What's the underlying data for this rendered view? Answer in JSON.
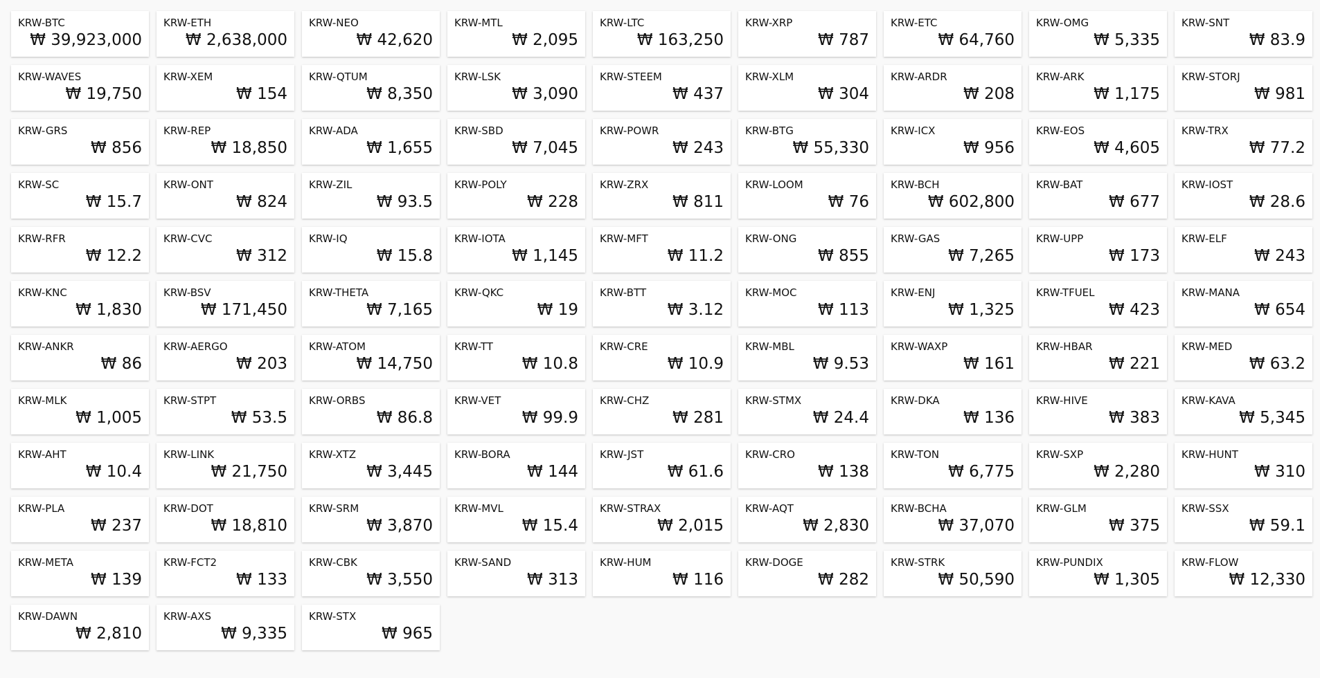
{
  "currency_symbol": "₩",
  "tickers": [
    {
      "market": "KRW-BTC",
      "price": "39,923,000"
    },
    {
      "market": "KRW-ETH",
      "price": "2,638,000"
    },
    {
      "market": "KRW-NEO",
      "price": "42,620"
    },
    {
      "market": "KRW-MTL",
      "price": "2,095"
    },
    {
      "market": "KRW-LTC",
      "price": "163,250"
    },
    {
      "market": "KRW-XRP",
      "price": "787"
    },
    {
      "market": "KRW-ETC",
      "price": "64,760"
    },
    {
      "market": "KRW-OMG",
      "price": "5,335"
    },
    {
      "market": "KRW-SNT",
      "price": "83.9"
    },
    {
      "market": "KRW-WAVES",
      "price": "19,750"
    },
    {
      "market": "KRW-XEM",
      "price": "154"
    },
    {
      "market": "KRW-QTUM",
      "price": "8,350"
    },
    {
      "market": "KRW-LSK",
      "price": "3,090"
    },
    {
      "market": "KRW-STEEM",
      "price": "437"
    },
    {
      "market": "KRW-XLM",
      "price": "304"
    },
    {
      "market": "KRW-ARDR",
      "price": "208"
    },
    {
      "market": "KRW-ARK",
      "price": "1,175"
    },
    {
      "market": "KRW-STORJ",
      "price": "981"
    },
    {
      "market": "KRW-GRS",
      "price": "856"
    },
    {
      "market": "KRW-REP",
      "price": "18,850"
    },
    {
      "market": "KRW-ADA",
      "price": "1,655"
    },
    {
      "market": "KRW-SBD",
      "price": "7,045"
    },
    {
      "market": "KRW-POWR",
      "price": "243"
    },
    {
      "market": "KRW-BTG",
      "price": "55,330"
    },
    {
      "market": "KRW-ICX",
      "price": "956"
    },
    {
      "market": "KRW-EOS",
      "price": "4,605"
    },
    {
      "market": "KRW-TRX",
      "price": "77.2"
    },
    {
      "market": "KRW-SC",
      "price": "15.7"
    },
    {
      "market": "KRW-ONT",
      "price": "824"
    },
    {
      "market": "KRW-ZIL",
      "price": "93.5"
    },
    {
      "market": "KRW-POLY",
      "price": "228"
    },
    {
      "market": "KRW-ZRX",
      "price": "811"
    },
    {
      "market": "KRW-LOOM",
      "price": "76"
    },
    {
      "market": "KRW-BCH",
      "price": "602,800"
    },
    {
      "market": "KRW-BAT",
      "price": "677"
    },
    {
      "market": "KRW-IOST",
      "price": "28.6"
    },
    {
      "market": "KRW-RFR",
      "price": "12.2"
    },
    {
      "market": "KRW-CVC",
      "price": "312"
    },
    {
      "market": "KRW-IQ",
      "price": "15.8"
    },
    {
      "market": "KRW-IOTA",
      "price": "1,145"
    },
    {
      "market": "KRW-MFT",
      "price": "11.2"
    },
    {
      "market": "KRW-ONG",
      "price": "855"
    },
    {
      "market": "KRW-GAS",
      "price": "7,265"
    },
    {
      "market": "KRW-UPP",
      "price": "173"
    },
    {
      "market": "KRW-ELF",
      "price": "243"
    },
    {
      "market": "KRW-KNC",
      "price": "1,830"
    },
    {
      "market": "KRW-BSV",
      "price": "171,450"
    },
    {
      "market": "KRW-THETA",
      "price": "7,165"
    },
    {
      "market": "KRW-QKC",
      "price": "19"
    },
    {
      "market": "KRW-BTT",
      "price": "3.12"
    },
    {
      "market": "KRW-MOC",
      "price": "113"
    },
    {
      "market": "KRW-ENJ",
      "price": "1,325"
    },
    {
      "market": "KRW-TFUEL",
      "price": "423"
    },
    {
      "market": "KRW-MANA",
      "price": "654"
    },
    {
      "market": "KRW-ANKR",
      "price": "86"
    },
    {
      "market": "KRW-AERGO",
      "price": "203"
    },
    {
      "market": "KRW-ATOM",
      "price": "14,750"
    },
    {
      "market": "KRW-TT",
      "price": "10.8"
    },
    {
      "market": "KRW-CRE",
      "price": "10.9"
    },
    {
      "market": "KRW-MBL",
      "price": "9.53"
    },
    {
      "market": "KRW-WAXP",
      "price": "161"
    },
    {
      "market": "KRW-HBAR",
      "price": "221"
    },
    {
      "market": "KRW-MED",
      "price": "63.2"
    },
    {
      "market": "KRW-MLK",
      "price": "1,005"
    },
    {
      "market": "KRW-STPT",
      "price": "53.5"
    },
    {
      "market": "KRW-ORBS",
      "price": "86.8"
    },
    {
      "market": "KRW-VET",
      "price": "99.9"
    },
    {
      "market": "KRW-CHZ",
      "price": "281"
    },
    {
      "market": "KRW-STMX",
      "price": "24.4"
    },
    {
      "market": "KRW-DKA",
      "price": "136"
    },
    {
      "market": "KRW-HIVE",
      "price": "383"
    },
    {
      "market": "KRW-KAVA",
      "price": "5,345"
    },
    {
      "market": "KRW-AHT",
      "price": "10.4"
    },
    {
      "market": "KRW-LINK",
      "price": "21,750"
    },
    {
      "market": "KRW-XTZ",
      "price": "3,445"
    },
    {
      "market": "KRW-BORA",
      "price": "144"
    },
    {
      "market": "KRW-JST",
      "price": "61.6"
    },
    {
      "market": "KRW-CRO",
      "price": "138"
    },
    {
      "market": "KRW-TON",
      "price": "6,775"
    },
    {
      "market": "KRW-SXP",
      "price": "2,280"
    },
    {
      "market": "KRW-HUNT",
      "price": "310"
    },
    {
      "market": "KRW-PLA",
      "price": "237"
    },
    {
      "market": "KRW-DOT",
      "price": "18,810"
    },
    {
      "market": "KRW-SRM",
      "price": "3,870"
    },
    {
      "market": "KRW-MVL",
      "price": "15.4"
    },
    {
      "market": "KRW-STRAX",
      "price": "2,015"
    },
    {
      "market": "KRW-AQT",
      "price": "2,830"
    },
    {
      "market": "KRW-BCHA",
      "price": "37,070"
    },
    {
      "market": "KRW-GLM",
      "price": "375"
    },
    {
      "market": "KRW-SSX",
      "price": "59.1"
    },
    {
      "market": "KRW-META",
      "price": "139"
    },
    {
      "market": "KRW-FCT2",
      "price": "133"
    },
    {
      "market": "KRW-CBK",
      "price": "3,550"
    },
    {
      "market": "KRW-SAND",
      "price": "313"
    },
    {
      "market": "KRW-HUM",
      "price": "116"
    },
    {
      "market": "KRW-DOGE",
      "price": "282"
    },
    {
      "market": "KRW-STRK",
      "price": "50,590"
    },
    {
      "market": "KRW-PUNDIX",
      "price": "1,305"
    },
    {
      "market": "KRW-FLOW",
      "price": "12,330"
    },
    {
      "market": "KRW-DAWN",
      "price": "2,810"
    },
    {
      "market": "KRW-AXS",
      "price": "9,335"
    },
    {
      "market": "KRW-STX",
      "price": "965"
    }
  ]
}
